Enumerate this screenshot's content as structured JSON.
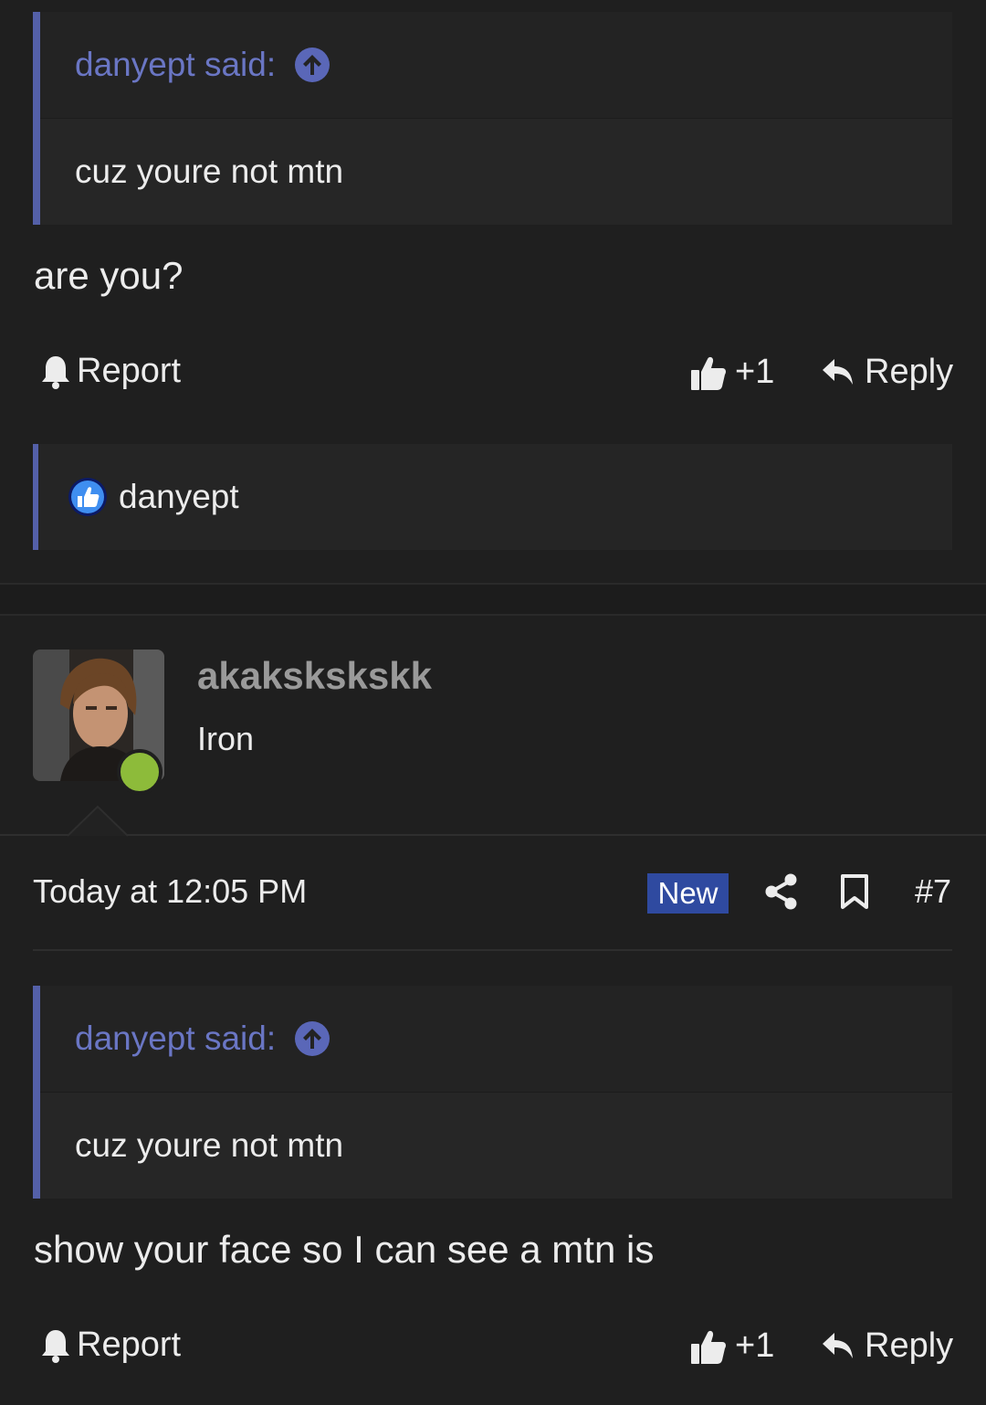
{
  "post1": {
    "quote_author": "danyept said:",
    "quote_text": "cuz youre not mtn",
    "body": "are you?",
    "report_label": "Report",
    "like_count": "+1",
    "reply_label": "Reply",
    "reaction_user": "danyept"
  },
  "post2": {
    "username": "akakskskskk",
    "user_title": "Iron",
    "timestamp": "Today at 12:05 PM",
    "new_badge": "New",
    "post_number": "#7",
    "quote_author": "danyept said:",
    "quote_text": "cuz youre not mtn",
    "body": "show your face so I can see a mtn is",
    "report_label": "Report",
    "like_count": "+1",
    "reply_label": "Reply"
  },
  "colors": {
    "background": "#1f1f1f",
    "quote_accent": "#5460a8",
    "quote_author": "#6a76c4",
    "online": "#8dbb3a",
    "new_badge": "#2f4aa0"
  }
}
